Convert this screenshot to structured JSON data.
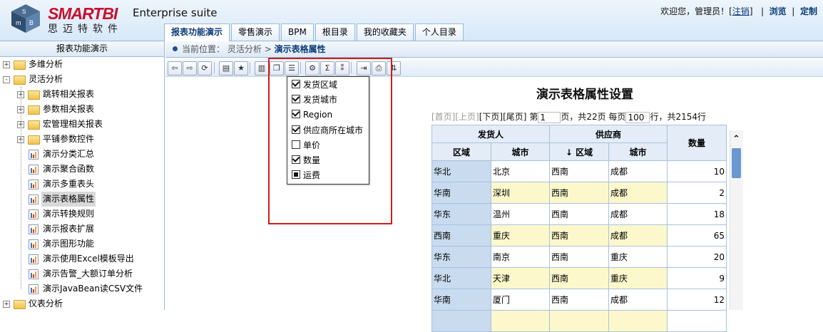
{
  "header": {
    "logo_letters": [
      "S",
      "m",
      "B",
      "i"
    ],
    "brand_latin": "SMARTBI",
    "brand_cn": "思迈特软件",
    "suite": "Enterprise suite",
    "welcome": "欢迎您，管理员！[",
    "logout": "注销",
    "welcome_end": "]",
    "sep": "|",
    "browse": "浏览",
    "customize": "定制",
    "tabs": [
      "报表功能演示",
      "零售演示",
      "BPM",
      "根目录",
      "我的收藏夹",
      "个人目录"
    ],
    "active_tab": 0
  },
  "left": {
    "title": "报表功能演示",
    "items": [
      {
        "label": "多维分析",
        "type": "folder",
        "level": 0,
        "toggle": "+"
      },
      {
        "label": "灵活分析",
        "type": "folder",
        "level": 0,
        "toggle": "-"
      },
      {
        "label": "跳转相关报表",
        "type": "folder",
        "level": 1,
        "toggle": "+"
      },
      {
        "label": "参数相关报表",
        "type": "folder",
        "level": 1,
        "toggle": "+"
      },
      {
        "label": "宏管理相关报表",
        "type": "folder",
        "level": 1,
        "toggle": "+"
      },
      {
        "label": "平铺参数控件",
        "type": "folder",
        "level": 1,
        "toggle": "+"
      },
      {
        "label": "演示分类汇总",
        "type": "report",
        "level": 1
      },
      {
        "label": "演示聚合函数",
        "type": "report",
        "level": 1
      },
      {
        "label": "演示多重表头",
        "type": "report",
        "level": 1
      },
      {
        "label": "演示表格属性",
        "type": "report",
        "level": 1,
        "selected": true
      },
      {
        "label": "演示转换规则",
        "type": "report",
        "level": 1
      },
      {
        "label": "演示报表扩展",
        "type": "report",
        "level": 1
      },
      {
        "label": "演示图形功能",
        "type": "report",
        "level": 1
      },
      {
        "label": "演示使用Excel模板导出",
        "type": "report",
        "level": 1
      },
      {
        "label": "演示告警_大额订单分析",
        "type": "report",
        "level": 1
      },
      {
        "label": "演示JavaBean读CSV文件",
        "type": "report",
        "level": 1
      },
      {
        "label": "仪表分析",
        "type": "folder",
        "level": 0,
        "toggle": "+"
      }
    ]
  },
  "breadcrumb": {
    "prefix": "当前位置：",
    "parent": "灵活分析",
    "arrow": ">",
    "current": "演示表格属性"
  },
  "toolbar": {
    "buttons": [
      "back-icon",
      "forward-icon",
      "refresh-icon",
      "save-icon",
      "favorite-icon",
      "chart-icon",
      "window-icon",
      "column-select-icon",
      "print-setup-icon",
      "sum-icon",
      "parameter-icon",
      "export-icon",
      "print-icon",
      "switch-icon"
    ],
    "glyphs": [
      "⇦",
      "⇨",
      "⟳",
      "▤",
      "★",
      "▥",
      "❐",
      "☰",
      "⚙",
      "Σ",
      "⁑",
      "⇥",
      "⎙",
      "⇅"
    ]
  },
  "column_menu": {
    "options": [
      {
        "label": "发货区域",
        "state": "checked"
      },
      {
        "label": "发货城市",
        "state": "checked"
      },
      {
        "label": "Region",
        "state": "checked"
      },
      {
        "label": "供应商所在城市",
        "state": "checked"
      },
      {
        "label": "单价",
        "state": "unchecked"
      },
      {
        "label": "数量",
        "state": "checked"
      },
      {
        "label": "运费",
        "state": "partial"
      }
    ]
  },
  "report": {
    "title": "演示表格属性设置",
    "pager": {
      "first": "[首页]",
      "prev": "[上页]",
      "next": "[下页]",
      "last": "[尾页]",
      "page_prefix": "第",
      "page": "1",
      "page_suffix": "页，共22页 每页",
      "per_page": "100",
      "rows_suffix": "行，共2154行"
    },
    "group_headers": [
      "发货人",
      "供应商",
      "数量"
    ],
    "sub_headers": [
      "区域",
      "城市",
      "↓ 区域",
      "城市"
    ],
    "rows": [
      [
        "华北",
        "北京",
        "西南",
        "成都",
        "10"
      ],
      [
        "华南",
        "深圳",
        "西南",
        "成都",
        "2"
      ],
      [
        "华东",
        "温州",
        "西南",
        "成都",
        "18"
      ],
      [
        "西南",
        "重庆",
        "西南",
        "成都",
        "65"
      ],
      [
        "华东",
        "南京",
        "西南",
        "重庆",
        "20"
      ],
      [
        "华北",
        "天津",
        "西南",
        "重庆",
        "9"
      ],
      [
        "华南",
        "厦门",
        "西南",
        "成都",
        "12"
      ],
      [
        "",
        "",
        "",
        "",
        ""
      ]
    ]
  },
  "scrollbar": {
    "up": "⌃"
  },
  "colors": {
    "accent": "#0b3a7a",
    "highlight": "#d21b1b",
    "region_cell": "#c8dbef",
    "alt_row": "#fdf8cc"
  }
}
